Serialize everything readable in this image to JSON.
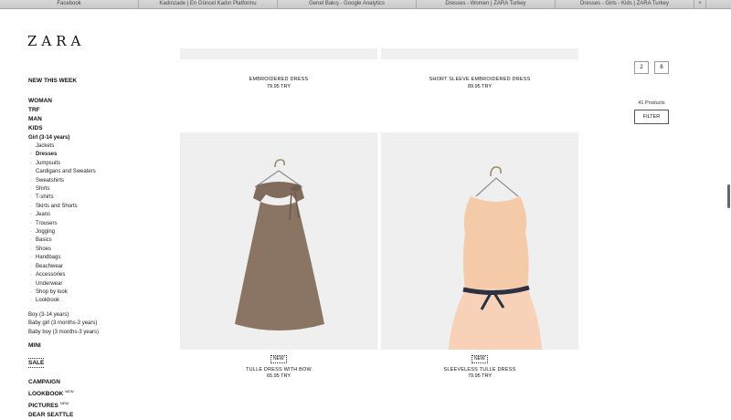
{
  "browser": {
    "tabs": [
      "Facebook",
      "Kadınzade | En Güncel Kadın Platformu",
      "Genel Bakış - Google Analytics",
      "Dresses - Women | ZARA Turkey",
      "Dresses - Girls - Kids | ZARA Turkey"
    ],
    "new_tab": "+"
  },
  "logo": "ZARA",
  "nav": {
    "new_this_week": "NEW THIS WEEK",
    "main": [
      "WOMAN",
      "TRF",
      "MAN",
      "KIDS"
    ],
    "girl": "Girl (3-14 years)",
    "girl_items": [
      "Jackets",
      "Dresses",
      "Jumpsuits",
      "Cardigans and Sweaters",
      "Sweatshirts",
      "Shirts",
      "T-shirts",
      "Skirts and Shorts",
      "Jeans",
      "Trousers",
      "Jogging",
      "Basics",
      "Shoes",
      "Handbags",
      "Beachwear",
      "Accessories",
      "Underwear",
      "Shop by look",
      "Lookbook"
    ],
    "kids_other": [
      "Boy (3-14 years)",
      "Baby girl (3 months-3 years)",
      "Baby boy (3 months-3 years)"
    ],
    "mini": "MINI",
    "sale": "SALE",
    "bottom": {
      "campaign": "CAMPAIGN",
      "lookbook": "LOOKBOOK",
      "lookbook_badge": "NEW",
      "pictures": "PICTURES",
      "pictures_badge": "NEW",
      "dear_seattle": "DEAR SEATTLE"
    }
  },
  "products_top": [
    {
      "name": "EMBROIDERED DRESS",
      "price": "79.95 TRY"
    },
    {
      "name": "SHORT SLEEVE EMBROIDERED DRESS",
      "price": "89.95 TRY"
    }
  ],
  "products": [
    {
      "badge": "NEW",
      "name": "TULLE DRESS WITH BOW",
      "price": "65.95 TRY",
      "color": "#8a7565"
    },
    {
      "badge": "NEW",
      "name": "SLEEVELESS TULLE DRESS",
      "price": "79.95 TRY",
      "color": "#f7c9a8"
    }
  ],
  "pagination": [
    "2",
    "6"
  ],
  "product_count": "41 Products",
  "filter_label": "FILTER"
}
